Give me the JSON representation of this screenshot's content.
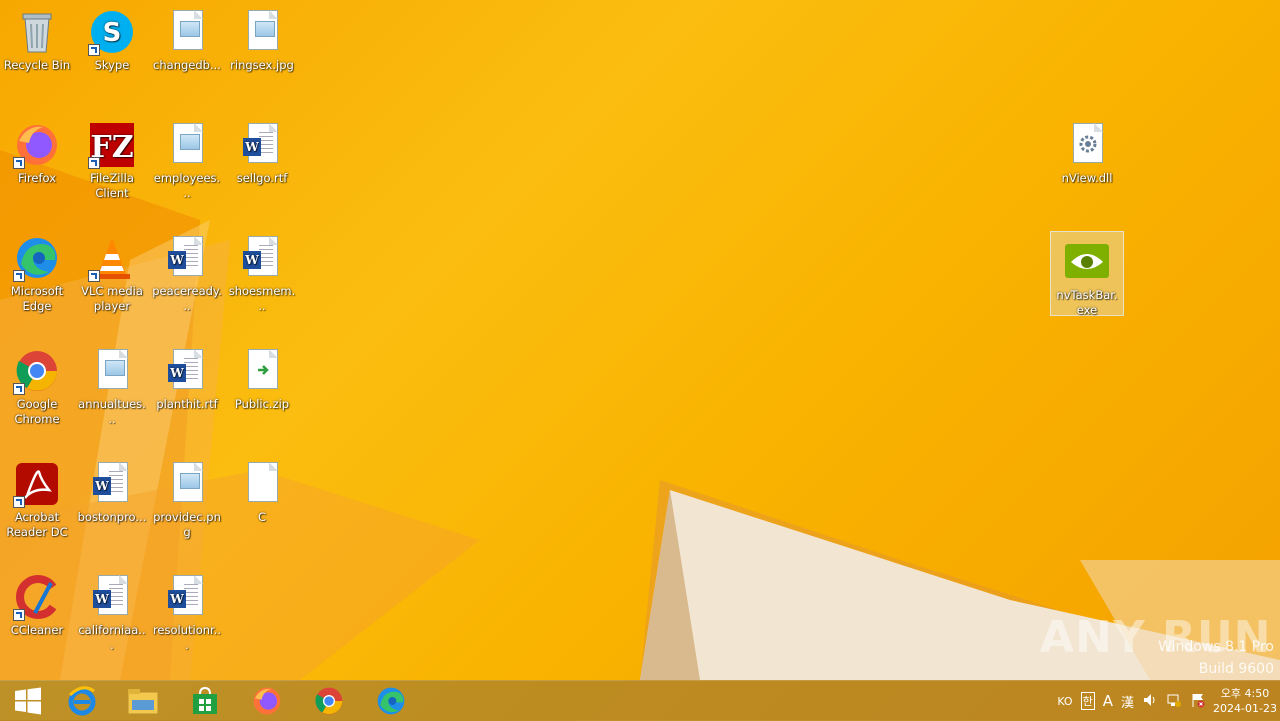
{
  "desktop": {
    "icons": [
      {
        "label": "Recycle Bin"
      },
      {
        "label": "Skype"
      },
      {
        "label": "changedb..."
      },
      {
        "label": "ringsex.jpg"
      },
      {
        "label": "Firefox"
      },
      {
        "label": "FileZilla Client"
      },
      {
        "label": "employees..."
      },
      {
        "label": "sellgo.rtf"
      },
      {
        "label": "Microsoft Edge"
      },
      {
        "label": "VLC media player"
      },
      {
        "label": "peaceready..."
      },
      {
        "label": "shoesmem..."
      },
      {
        "label": "Google Chrome"
      },
      {
        "label": "annualtues..."
      },
      {
        "label": "planthit.rtf"
      },
      {
        "label": "Public.zip"
      },
      {
        "label": "Acrobat Reader DC"
      },
      {
        "label": "bostonpro..."
      },
      {
        "label": "providec.png"
      },
      {
        "label": "C"
      },
      {
        "label": "CCleaner"
      },
      {
        "label": "californiaa..."
      },
      {
        "label": "resolutionr..."
      },
      {
        "label": "nView.dll"
      },
      {
        "label": "nvTaskBar.exe"
      }
    ]
  },
  "watermark": {
    "brand": "ANY RUN",
    "line1": "Windows 8.1 Pro",
    "line2": "Build 9600"
  },
  "taskbar": {
    "tray": {
      "lang": "KO",
      "ime1": "한",
      "ime2": "A",
      "ime3": "漢",
      "time": "오후 4:50",
      "date": "2024-01-23"
    }
  }
}
